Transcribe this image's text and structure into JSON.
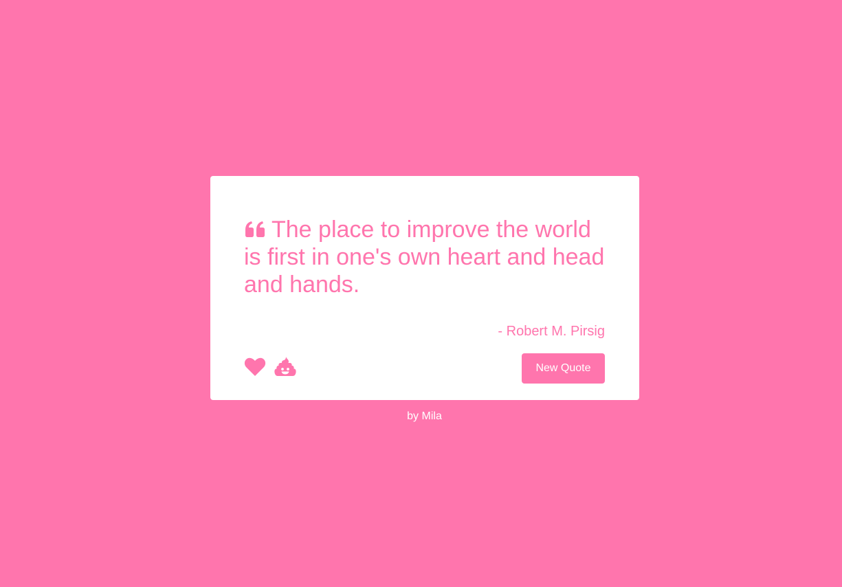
{
  "colors": {
    "background": "#ff75ad",
    "card": "#ffffff",
    "accent": "#ff75ad",
    "button_text": "#ffffff"
  },
  "quote": {
    "icon": "quote-left-icon",
    "text": "The place to improve the world is first in one's own heart and head and hands.",
    "author": "- Robert M. Pirsig"
  },
  "actions": {
    "like_icon": "heart-icon",
    "dislike_icon": "poop-icon",
    "new_quote_label": "New Quote"
  },
  "footer": {
    "credit": "by Mila"
  }
}
